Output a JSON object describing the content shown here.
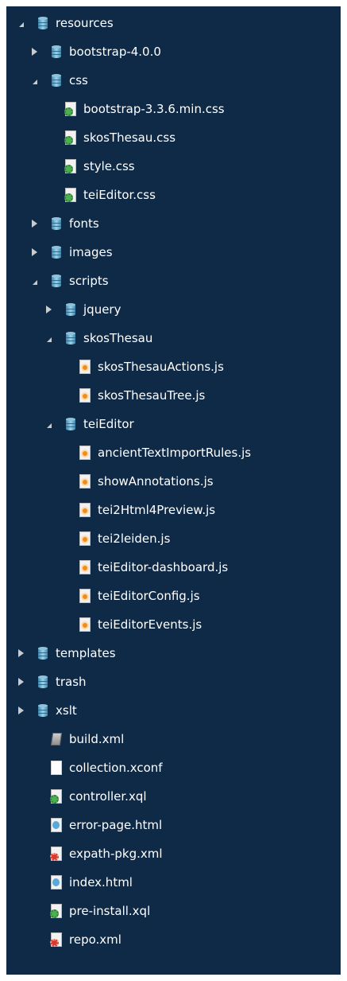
{
  "colors": {
    "panel_bg": "#0f2a47",
    "text": "#ffffff",
    "arrow": "#c8ccd1"
  },
  "tree": [
    {
      "label": "resources",
      "icon": "folder-icon",
      "state": "expanded",
      "level": 0
    },
    {
      "label": "bootstrap-4.0.0",
      "icon": "folder-icon",
      "state": "collapsed",
      "level": 1
    },
    {
      "label": "css",
      "icon": "folder-icon",
      "state": "expanded",
      "level": 1
    },
    {
      "label": "bootstrap-3.3.6.min.css",
      "icon": "css-file-icon",
      "state": "leaf",
      "level": 2
    },
    {
      "label": "skosThesau.css",
      "icon": "css-file-icon",
      "state": "leaf",
      "level": 2
    },
    {
      "label": "style.css",
      "icon": "css-file-icon",
      "state": "leaf",
      "level": 2
    },
    {
      "label": "teiEditor.css",
      "icon": "css-file-icon",
      "state": "leaf",
      "level": 2
    },
    {
      "label": "fonts",
      "icon": "folder-icon",
      "state": "collapsed",
      "level": 1
    },
    {
      "label": "images",
      "icon": "folder-icon",
      "state": "collapsed",
      "level": 1
    },
    {
      "label": "scripts",
      "icon": "folder-icon",
      "state": "expanded",
      "level": 1
    },
    {
      "label": "jquery",
      "icon": "folder-icon",
      "state": "collapsed",
      "level": 2
    },
    {
      "label": "skosThesau",
      "icon": "folder-icon",
      "state": "expanded",
      "level": 2
    },
    {
      "label": "skosThesauActions.js",
      "icon": "js-file-icon",
      "state": "leaf",
      "level": 3
    },
    {
      "label": "skosThesauTree.js",
      "icon": "js-file-icon",
      "state": "leaf",
      "level": 3
    },
    {
      "label": "teiEditor",
      "icon": "folder-icon",
      "state": "expanded",
      "level": 2
    },
    {
      "label": "ancientTextImportRules.js",
      "icon": "js-file-icon",
      "state": "leaf",
      "level": 3
    },
    {
      "label": "showAnnotations.js",
      "icon": "js-file-icon",
      "state": "leaf",
      "level": 3
    },
    {
      "label": "tei2Html4Preview.js",
      "icon": "js-file-icon",
      "state": "leaf",
      "level": 3
    },
    {
      "label": "tei2leiden.js",
      "icon": "js-file-icon",
      "state": "leaf",
      "level": 3
    },
    {
      "label": "teiEditor-dashboard.js",
      "icon": "js-file-icon",
      "state": "leaf",
      "level": 3
    },
    {
      "label": "teiEditorConfig.js",
      "icon": "js-file-icon",
      "state": "leaf",
      "level": 3
    },
    {
      "label": "teiEditorEvents.js",
      "icon": "js-file-icon",
      "state": "leaf",
      "level": 3
    },
    {
      "label": "templates",
      "icon": "folder-icon",
      "state": "collapsed",
      "level": 0
    },
    {
      "label": "trash",
      "icon": "folder-icon",
      "state": "collapsed",
      "level": 0
    },
    {
      "label": "xslt",
      "icon": "folder-icon",
      "state": "collapsed",
      "level": 0
    },
    {
      "label": "build.xml",
      "icon": "ant-build-file-icon",
      "state": "leaf",
      "level": 1
    },
    {
      "label": "collection.xconf",
      "icon": "blank-file-icon",
      "state": "leaf",
      "level": 1
    },
    {
      "label": "controller.xql",
      "icon": "xquery-file-icon",
      "state": "leaf",
      "level": 1
    },
    {
      "label": "error-page.html",
      "icon": "html-file-icon",
      "state": "leaf",
      "level": 1
    },
    {
      "label": "expath-pkg.xml",
      "icon": "xml-file-icon",
      "state": "leaf",
      "level": 1
    },
    {
      "label": "index.html",
      "icon": "html-file-icon",
      "state": "leaf",
      "level": 1
    },
    {
      "label": "pre-install.xql",
      "icon": "xquery-file-icon",
      "state": "leaf",
      "level": 1
    },
    {
      "label": "repo.xml",
      "icon": "xml-file-icon",
      "state": "leaf",
      "level": 1
    }
  ]
}
